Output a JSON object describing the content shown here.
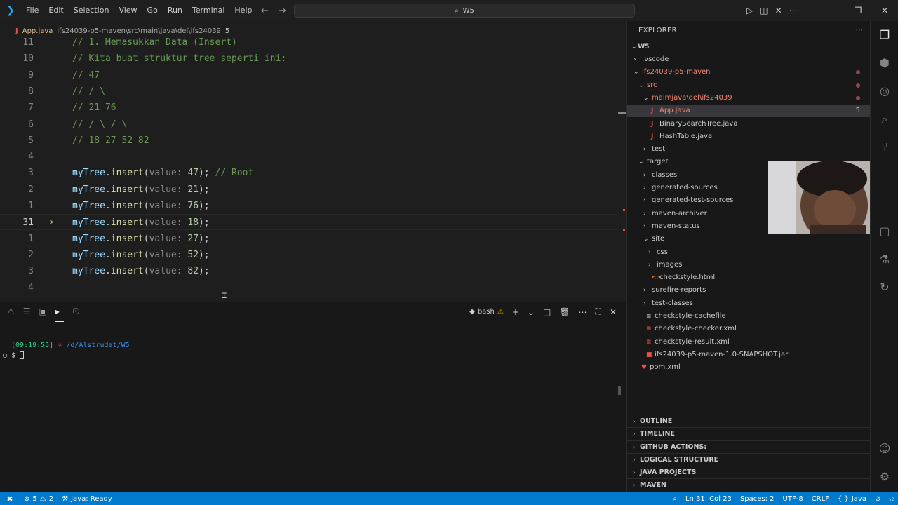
{
  "menu": [
    "File",
    "Edit",
    "Selection",
    "View",
    "Go",
    "Run",
    "Terminal",
    "Help"
  ],
  "search": {
    "text": "W5"
  },
  "breadcrumb": {
    "file": "App.java",
    "path": "ifs24039-p5-maven\\src\\main\\java\\del\\ifs24039",
    "count": "5"
  },
  "editor": {
    "lines": [
      {
        "num": "11",
        "kind": "comment",
        "text": "// 1. Memasukkan Data (Insert)"
      },
      {
        "num": "10",
        "kind": "comment",
        "text": "// Kita buat struktur tree seperti ini:"
      },
      {
        "num": "9",
        "kind": "comment",
        "text": "// 47"
      },
      {
        "num": "8",
        "kind": "comment",
        "text": "// / \\"
      },
      {
        "num": "7",
        "kind": "comment",
        "text": "// 21 76"
      },
      {
        "num": "6",
        "kind": "comment",
        "text": "// / \\ / \\"
      },
      {
        "num": "5",
        "kind": "comment",
        "text": "// 18 27 52 82"
      },
      {
        "num": "4",
        "kind": "blank",
        "text": ""
      },
      {
        "num": "3",
        "kind": "call",
        "obj": "myTree",
        "method": "insert",
        "hint": "value:",
        "arg": "47",
        "comment": "// Root"
      },
      {
        "num": "2",
        "kind": "call",
        "obj": "myTree",
        "method": "insert",
        "hint": "value:",
        "arg": "21",
        "comment": ""
      },
      {
        "num": "1",
        "kind": "call",
        "obj": "myTree",
        "method": "insert",
        "hint": "value:",
        "arg": "76",
        "comment": ""
      },
      {
        "num": "31",
        "kind": "call",
        "obj": "myTree",
        "method": "insert",
        "hint": "value:",
        "arg": "18",
        "comment": "",
        "current": true
      },
      {
        "num": "1",
        "kind": "call",
        "obj": "myTree",
        "method": "insert",
        "hint": "value:",
        "arg": "27",
        "comment": ""
      },
      {
        "num": "2",
        "kind": "call",
        "obj": "myTree",
        "method": "insert",
        "hint": "value:",
        "arg": "52",
        "comment": ""
      },
      {
        "num": "3",
        "kind": "call",
        "obj": "myTree",
        "method": "insert",
        "hint": "value:",
        "arg": "82",
        "comment": ""
      },
      {
        "num": "4",
        "kind": "blank",
        "text": ""
      }
    ]
  },
  "terminal": {
    "shell": "bash",
    "time": "[09:19:55]",
    "path": "/d/Alstrudat/W5",
    "prompt": "$"
  },
  "explorer": {
    "title": "EXPLORER",
    "root": "W5",
    "items": [
      {
        "label": ".vscode",
        "depth": 1,
        "type": "folder",
        "open": false,
        "style": ""
      },
      {
        "label": "ifs24039-p5-maven",
        "depth": 1,
        "type": "folder",
        "open": true,
        "style": "errfile",
        "dot": true
      },
      {
        "label": "src",
        "depth": 2,
        "type": "folder",
        "open": true,
        "style": "errfile",
        "dot": true
      },
      {
        "label": "main\\java\\del\\ifs24039",
        "depth": 3,
        "type": "folder",
        "open": true,
        "style": "errfile",
        "dot": true
      },
      {
        "label": "App.java",
        "depth": 4,
        "type": "java",
        "style": "errfile",
        "badge": "5",
        "selected": true
      },
      {
        "label": "BinarySearchTree.java",
        "depth": 4,
        "type": "java",
        "style": ""
      },
      {
        "label": "HashTable.java",
        "depth": 4,
        "type": "java",
        "style": ""
      },
      {
        "label": "test",
        "depth": 3,
        "type": "folder",
        "open": false,
        "style": ""
      },
      {
        "label": "target",
        "depth": 2,
        "type": "folder",
        "open": true,
        "style": ""
      },
      {
        "label": "classes",
        "depth": 3,
        "type": "folder",
        "open": false,
        "style": ""
      },
      {
        "label": "generated-sources",
        "depth": 3,
        "type": "folder",
        "open": false,
        "style": ""
      },
      {
        "label": "generated-test-sources",
        "depth": 3,
        "type": "folder",
        "open": false,
        "style": ""
      },
      {
        "label": "maven-archiver",
        "depth": 3,
        "type": "folder",
        "open": false,
        "style": ""
      },
      {
        "label": "maven-status",
        "depth": 3,
        "type": "folder",
        "open": false,
        "style": ""
      },
      {
        "label": "site",
        "depth": 3,
        "type": "folder",
        "open": true,
        "style": ""
      },
      {
        "label": "css",
        "depth": 4,
        "type": "folder",
        "open": false,
        "style": ""
      },
      {
        "label": "images",
        "depth": 4,
        "type": "folder",
        "open": false,
        "style": ""
      },
      {
        "label": "checkstyle.html",
        "depth": 4,
        "type": "html",
        "style": ""
      },
      {
        "label": "surefire-reports",
        "depth": 3,
        "type": "folder",
        "open": false,
        "style": ""
      },
      {
        "label": "test-classes",
        "depth": 3,
        "type": "folder",
        "open": false,
        "style": ""
      },
      {
        "label": "checkstyle-cachefile",
        "depth": 3,
        "type": "file",
        "style": ""
      },
      {
        "label": "checkstyle-checker.xml",
        "depth": 3,
        "type": "xml",
        "style": ""
      },
      {
        "label": "checkstyle-result.xml",
        "depth": 3,
        "type": "xml",
        "style": ""
      },
      {
        "label": "ifs24039-p5-maven-1.0-SNAPSHOT.jar",
        "depth": 3,
        "type": "jar",
        "style": ""
      },
      {
        "label": "pom.xml",
        "depth": 2,
        "type": "pom",
        "style": ""
      }
    ],
    "sections": [
      "OUTLINE",
      "TIMELINE",
      "GITHUB ACTIONS:",
      "LOGICAL STRUCTURE",
      "JAVA PROJECTS",
      "MAVEN"
    ]
  },
  "status": {
    "errors": "5",
    "warnings": "2",
    "java": "Java: Ready",
    "position": "Ln 31, Col 23",
    "spaces": "Spaces: 2",
    "encoding": "UTF-8",
    "eol": "CRLF",
    "language": "Java"
  },
  "colors": {
    "accent": "#007acc",
    "error": "#f14c4c",
    "comment": "#6a9955",
    "number": "#b5cea8"
  }
}
